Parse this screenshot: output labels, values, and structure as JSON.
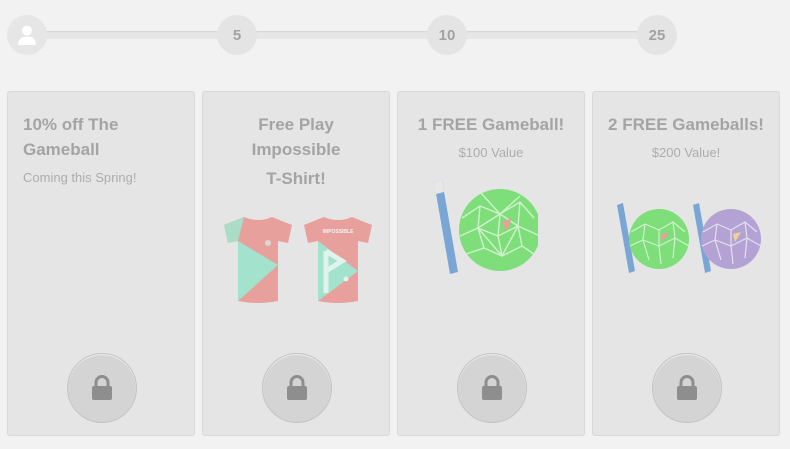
{
  "progress": {
    "milestones": [
      "5",
      "10",
      "25"
    ]
  },
  "rewards": [
    {
      "title": "10% off The Gameball",
      "subtitle": "Coming this Spring!",
      "status_icon": "lock-icon"
    },
    {
      "title": "Free Play Impossible",
      "title_line2": "T-Shirt!",
      "status_icon": "lock-icon"
    },
    {
      "title": "1 FREE Gameball!",
      "subtitle": "$100 Value",
      "status_icon": "lock-icon"
    },
    {
      "title": "2 FREE Gameballs!",
      "subtitle": "$200 Value!",
      "status_icon": "lock-icon"
    }
  ],
  "shirt_text": "IMPOSSIBLE",
  "colors": {
    "background": "#f2f2f2",
    "card": "#e5e5e5",
    "text": "#a4a4a4",
    "shirt_red": "#e8a09c",
    "shirt_teal": "#a3e2cc",
    "ball_green": "#7ede7a",
    "ball_purple": "#b4a2d4",
    "stand_blue": "#7aa6d6"
  }
}
